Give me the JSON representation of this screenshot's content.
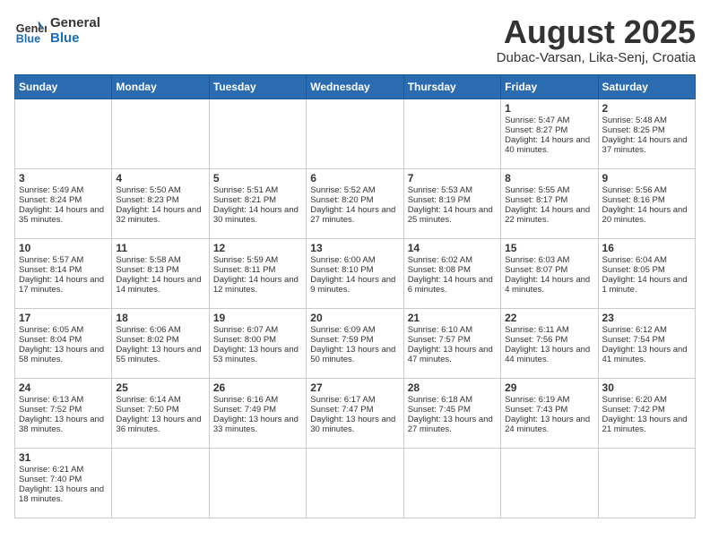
{
  "logo": {
    "general": "General",
    "blue": "Blue"
  },
  "header": {
    "title": "August 2025",
    "subtitle": "Dubac-Varsan, Lika-Senj, Croatia"
  },
  "weekdays": [
    "Sunday",
    "Monday",
    "Tuesday",
    "Wednesday",
    "Thursday",
    "Friday",
    "Saturday"
  ],
  "weeks": [
    [
      {
        "day": "",
        "info": ""
      },
      {
        "day": "",
        "info": ""
      },
      {
        "day": "",
        "info": ""
      },
      {
        "day": "",
        "info": ""
      },
      {
        "day": "",
        "info": ""
      },
      {
        "day": "1",
        "info": "Sunrise: 5:47 AM\nSunset: 8:27 PM\nDaylight: 14 hours and 40 minutes."
      },
      {
        "day": "2",
        "info": "Sunrise: 5:48 AM\nSunset: 8:25 PM\nDaylight: 14 hours and 37 minutes."
      }
    ],
    [
      {
        "day": "3",
        "info": "Sunrise: 5:49 AM\nSunset: 8:24 PM\nDaylight: 14 hours and 35 minutes."
      },
      {
        "day": "4",
        "info": "Sunrise: 5:50 AM\nSunset: 8:23 PM\nDaylight: 14 hours and 32 minutes."
      },
      {
        "day": "5",
        "info": "Sunrise: 5:51 AM\nSunset: 8:21 PM\nDaylight: 14 hours and 30 minutes."
      },
      {
        "day": "6",
        "info": "Sunrise: 5:52 AM\nSunset: 8:20 PM\nDaylight: 14 hours and 27 minutes."
      },
      {
        "day": "7",
        "info": "Sunrise: 5:53 AM\nSunset: 8:19 PM\nDaylight: 14 hours and 25 minutes."
      },
      {
        "day": "8",
        "info": "Sunrise: 5:55 AM\nSunset: 8:17 PM\nDaylight: 14 hours and 22 minutes."
      },
      {
        "day": "9",
        "info": "Sunrise: 5:56 AM\nSunset: 8:16 PM\nDaylight: 14 hours and 20 minutes."
      }
    ],
    [
      {
        "day": "10",
        "info": "Sunrise: 5:57 AM\nSunset: 8:14 PM\nDaylight: 14 hours and 17 minutes."
      },
      {
        "day": "11",
        "info": "Sunrise: 5:58 AM\nSunset: 8:13 PM\nDaylight: 14 hours and 14 minutes."
      },
      {
        "day": "12",
        "info": "Sunrise: 5:59 AM\nSunset: 8:11 PM\nDaylight: 14 hours and 12 minutes."
      },
      {
        "day": "13",
        "info": "Sunrise: 6:00 AM\nSunset: 8:10 PM\nDaylight: 14 hours and 9 minutes."
      },
      {
        "day": "14",
        "info": "Sunrise: 6:02 AM\nSunset: 8:08 PM\nDaylight: 14 hours and 6 minutes."
      },
      {
        "day": "15",
        "info": "Sunrise: 6:03 AM\nSunset: 8:07 PM\nDaylight: 14 hours and 4 minutes."
      },
      {
        "day": "16",
        "info": "Sunrise: 6:04 AM\nSunset: 8:05 PM\nDaylight: 14 hours and 1 minute."
      }
    ],
    [
      {
        "day": "17",
        "info": "Sunrise: 6:05 AM\nSunset: 8:04 PM\nDaylight: 13 hours and 58 minutes."
      },
      {
        "day": "18",
        "info": "Sunrise: 6:06 AM\nSunset: 8:02 PM\nDaylight: 13 hours and 55 minutes."
      },
      {
        "day": "19",
        "info": "Sunrise: 6:07 AM\nSunset: 8:00 PM\nDaylight: 13 hours and 53 minutes."
      },
      {
        "day": "20",
        "info": "Sunrise: 6:09 AM\nSunset: 7:59 PM\nDaylight: 13 hours and 50 minutes."
      },
      {
        "day": "21",
        "info": "Sunrise: 6:10 AM\nSunset: 7:57 PM\nDaylight: 13 hours and 47 minutes."
      },
      {
        "day": "22",
        "info": "Sunrise: 6:11 AM\nSunset: 7:56 PM\nDaylight: 13 hours and 44 minutes."
      },
      {
        "day": "23",
        "info": "Sunrise: 6:12 AM\nSunset: 7:54 PM\nDaylight: 13 hours and 41 minutes."
      }
    ],
    [
      {
        "day": "24",
        "info": "Sunrise: 6:13 AM\nSunset: 7:52 PM\nDaylight: 13 hours and 38 minutes."
      },
      {
        "day": "25",
        "info": "Sunrise: 6:14 AM\nSunset: 7:50 PM\nDaylight: 13 hours and 36 minutes."
      },
      {
        "day": "26",
        "info": "Sunrise: 6:16 AM\nSunset: 7:49 PM\nDaylight: 13 hours and 33 minutes."
      },
      {
        "day": "27",
        "info": "Sunrise: 6:17 AM\nSunset: 7:47 PM\nDaylight: 13 hours and 30 minutes."
      },
      {
        "day": "28",
        "info": "Sunrise: 6:18 AM\nSunset: 7:45 PM\nDaylight: 13 hours and 27 minutes."
      },
      {
        "day": "29",
        "info": "Sunrise: 6:19 AM\nSunset: 7:43 PM\nDaylight: 13 hours and 24 minutes."
      },
      {
        "day": "30",
        "info": "Sunrise: 6:20 AM\nSunset: 7:42 PM\nDaylight: 13 hours and 21 minutes."
      }
    ],
    [
      {
        "day": "31",
        "info": "Sunrise: 6:21 AM\nSunset: 7:40 PM\nDaylight: 13 hours and 18 minutes."
      },
      {
        "day": "",
        "info": ""
      },
      {
        "day": "",
        "info": ""
      },
      {
        "day": "",
        "info": ""
      },
      {
        "day": "",
        "info": ""
      },
      {
        "day": "",
        "info": ""
      },
      {
        "day": "",
        "info": ""
      }
    ]
  ]
}
